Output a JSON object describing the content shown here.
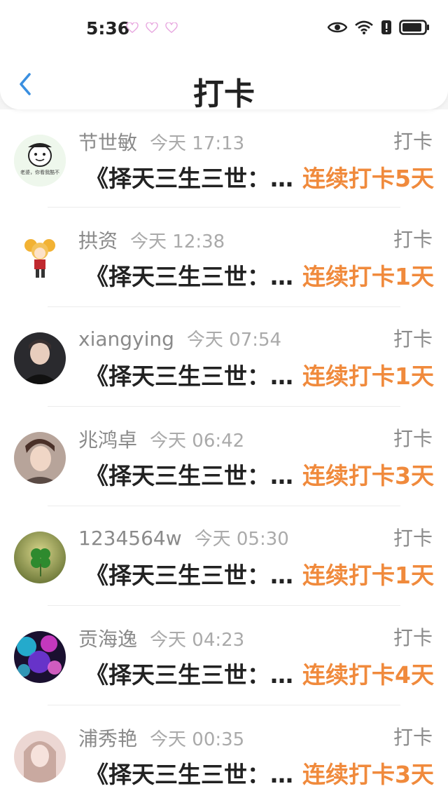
{
  "status_bar": {
    "time": "5:36",
    "icons": [
      "heart-icon",
      "heart-icon",
      "heart-icon",
      "eye-icon",
      "wifi-icon",
      "alert-icon",
      "battery-icon"
    ]
  },
  "header": {
    "title": "打卡",
    "back_icon": "chevron-left-icon"
  },
  "colors": {
    "accent": "#f08a3c",
    "back": "#3a8fe0"
  },
  "items": [
    {
      "name": "节世敏",
      "time": "今天 17:13",
      "action": "打卡",
      "content": "《择天三生三世：…",
      "streak": "连续打卡5天",
      "avatar": "cartoon-face"
    },
    {
      "name": "拱资",
      "time": "今天 12:38",
      "action": "打卡",
      "content": "《择天三生三世：…",
      "streak": "连续打卡1天",
      "avatar": "anime-girl"
    },
    {
      "name": "xiangying",
      "time": "今天 07:54",
      "action": "打卡",
      "content": "《择天三生三世：…",
      "streak": "连续打卡1天",
      "avatar": "portrait-man"
    },
    {
      "name": "兆鸿卓",
      "time": "今天 06:42",
      "action": "打卡",
      "content": "《择天三生三世：…",
      "streak": "连续打卡3天",
      "avatar": "portrait-boy"
    },
    {
      "name": "1234564w",
      "time": "今天 05:30",
      "action": "打卡",
      "content": "《择天三生三世：…",
      "streak": "连续打卡1天",
      "avatar": "clover"
    },
    {
      "name": "贡海逸",
      "time": "今天 04:23",
      "action": "打卡",
      "content": "《择天三生三世：…",
      "streak": "连续打卡4天",
      "avatar": "bokeh"
    },
    {
      "name": "浦秀艳",
      "time": "今天 00:35",
      "action": "打卡",
      "content": "《择天三生三世：…",
      "streak": "连续打卡3天",
      "avatar": "portrait-girl"
    }
  ]
}
